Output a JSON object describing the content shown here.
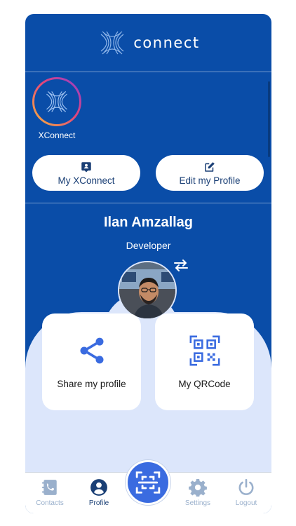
{
  "brand": {
    "name": "connect",
    "icon": "xconnect-logo-icon"
  },
  "organization": {
    "name": "XConnect",
    "icon": "xconnect-logo-icon"
  },
  "actions": {
    "my_xconnect": {
      "label": "My XConnect",
      "icon": "badge-icon"
    },
    "edit_profile": {
      "label": "Edit my Profile",
      "icon": "edit-icon"
    }
  },
  "profile": {
    "name": "Ilan Amzallag",
    "role": "Developer",
    "swap_icon": "swap-arrows-icon"
  },
  "cards": {
    "share": {
      "label": "Share my profile",
      "icon": "share-icon"
    },
    "qr": {
      "label": "My QRCode",
      "icon": "qr-code-icon"
    }
  },
  "nav": {
    "contacts": {
      "label": "Contacts",
      "icon": "contacts-book-icon",
      "active": false
    },
    "profile": {
      "label": "Profile",
      "icon": "user-circle-icon",
      "active": true
    },
    "scan": {
      "icon": "scan-icon"
    },
    "settings": {
      "label": "Settings",
      "icon": "gear-icon",
      "active": false
    },
    "logout": {
      "label": "Logout",
      "icon": "power-icon",
      "active": false
    }
  },
  "colors": {
    "primary": "#0a4da8",
    "accent": "#3a6be0",
    "light_bg": "#dce6fb",
    "nav_inactive": "#9ab0cc"
  }
}
